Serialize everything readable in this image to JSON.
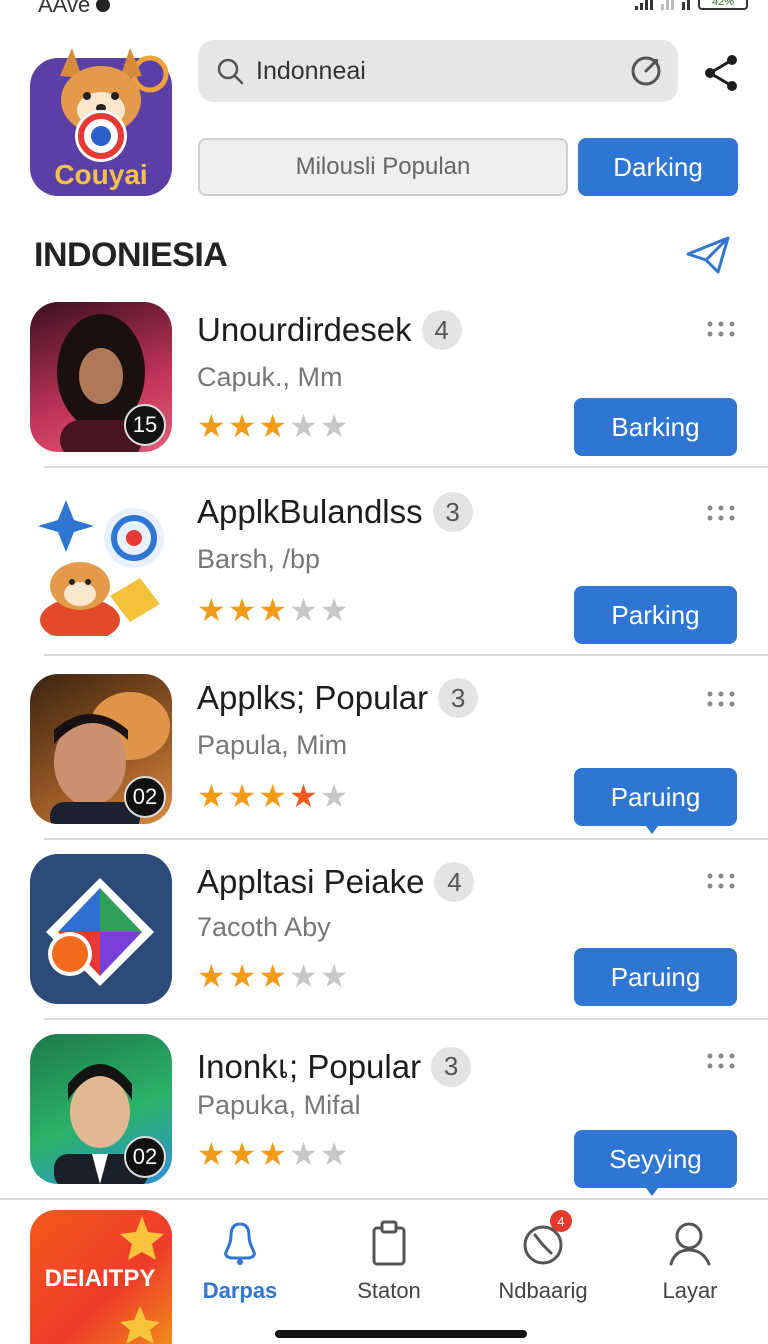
{
  "status_bar": {
    "carrier": "AAve",
    "battery": "42%"
  },
  "header": {
    "logo_text": "Couyai",
    "search_value": "Indonneai",
    "buttons": {
      "outline_label": "Milousli Populan",
      "blue_label": "Darking"
    }
  },
  "section": {
    "title": "INDONIESIA"
  },
  "apps": [
    {
      "title": "Unourdirdesek",
      "count": "4",
      "subtitle": "Capuk., Mm",
      "rating": 3,
      "badge": "15",
      "button": "Barking"
    },
    {
      "title": "ApplkBulandlss",
      "count": "3",
      "subtitle": "Barsh, /bp",
      "rating": 3,
      "badge": "",
      "button": "Parking"
    },
    {
      "title": "Applks; Popular",
      "count": "3",
      "subtitle": "Papula, Mim",
      "rating": 4,
      "badge": "02",
      "button": "Paruing"
    },
    {
      "title": "Appltasi Peiake",
      "count": "4",
      "subtitle": "7acoth Aby",
      "rating": 3,
      "badge": "",
      "button": "Paruing"
    },
    {
      "title": "Inonkเ; Popular",
      "count": "3",
      "subtitle": "Papuka, Mifal",
      "rating": 3,
      "badge": "02",
      "button": "Seyying"
    }
  ],
  "promo": {
    "label": "DEIAITPY"
  },
  "nav": {
    "items": [
      {
        "label": "Darpas",
        "icon": "location-pin-icon"
      },
      {
        "label": "Staton",
        "icon": "clipboard-icon"
      },
      {
        "label": "Ndbaarig",
        "icon": "clock-icon",
        "notification": "4"
      },
      {
        "label": "Layar",
        "icon": "person-icon"
      }
    ]
  },
  "colors": {
    "accent": "#2f76d2",
    "star": "#f39a17",
    "notification": "#e23b2e"
  }
}
